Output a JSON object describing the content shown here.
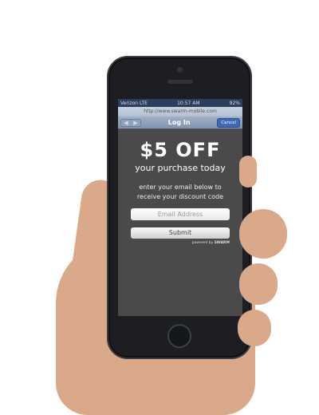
{
  "status": {
    "carrier": "Verizon LTE",
    "time": "10:57 AM",
    "battery": "92%"
  },
  "browser": {
    "url": "http://www.swarm-mobile.com",
    "back_icon": "◀",
    "forward_icon": "▶",
    "title": "Log In",
    "cancel_label": "Cancel"
  },
  "promo": {
    "headline": "$5 OFF",
    "subheadline": "your purchase today",
    "instruction_line1": "enter your email below to",
    "instruction_line2": "receive your discount code",
    "email_placeholder": "Email Address",
    "submit_label": "Submit",
    "powered_by": "powered by",
    "brand": "SWARM"
  }
}
